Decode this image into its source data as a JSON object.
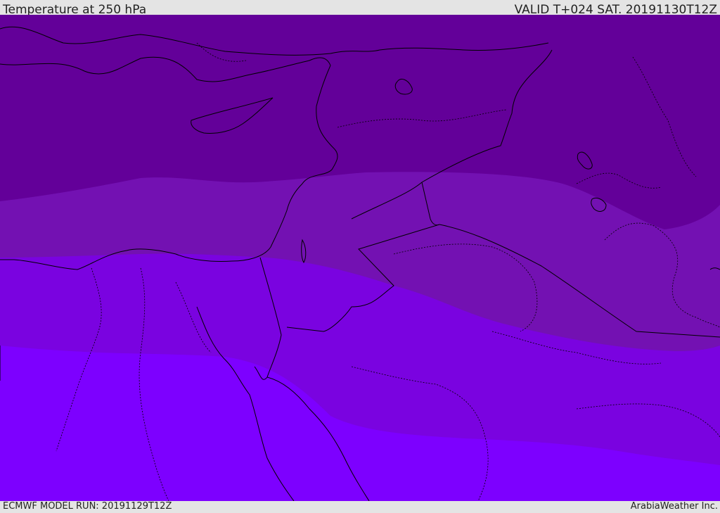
{
  "header": {
    "title": "Temperature at 250 hPa",
    "valid": "VALID T+024 SAT. 20191130T12Z"
  },
  "footer": {
    "model_run": "ECMWF MODEL RUN: 20191129T12Z",
    "credit": "ArabiaWeather Inc."
  },
  "map": {
    "field": "temperature",
    "level": "250 hPa",
    "band_colors": [
      "#630099",
      "#7311b2",
      "#7a03e0",
      "#7d00ff"
    ],
    "coastline_color": "#000000",
    "border_color": "#000000"
  }
}
